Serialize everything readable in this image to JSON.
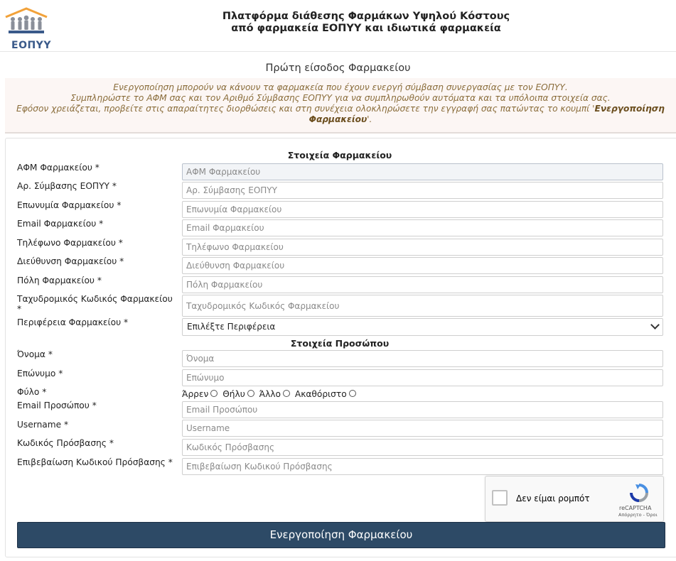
{
  "header": {
    "logo_text": "ΕΟΠΥΥ",
    "title_line1": "Πλατφόρμα διάθεσης Φαρμάκων Υψηλού Κόστους",
    "title_line2": "από φαρμακεία ΕΟΠΥΥ και ιδιωτικά φαρμακεία"
  },
  "page": {
    "subheading": "Πρώτη είσοδος Φαρμακείου"
  },
  "info": {
    "line1": "Ενεργοποίηση μπορούν να κάνουν τα φαρμακεία που έχουν ενεργή σύμβαση συνεργασίας με τον ΕΟΠΥΥ.",
    "line2": "Συμπληρώστε το ΑΦΜ σας και τον Αριθμό Σύμβασης ΕΟΠΥΥ για να συμπληρωθούν αυτόματα και τα υπόλοιπα στοιχεία σας.",
    "line3_prefix": "Εφόσον χρειάζεται, προβείτε στις απαραίτητες διορθώσεις και στη συνέχεια ολοκληρώσετε την εγγραφή σας πατώντας το κουμπί '",
    "line3_bold": "Ενεργοποίηση",
    "line4_bold": "Φαρμακείου",
    "line4_suffix": "'."
  },
  "pharmacy_section": {
    "title": "Στοιχεία Φαρμακείου",
    "fields": [
      {
        "label": "ΑΦΜ Φαρμακείου *",
        "placeholder": "ΑΦΜ Φαρμακείου",
        "value": ""
      },
      {
        "label": "Αρ. Σύμβασης ΕΟΠΥΥ *",
        "placeholder": "Αρ. Σύμβασης ΕΟΠΥΥ",
        "value": ""
      },
      {
        "label": "Επωνυμία Φαρμακείου *",
        "placeholder": "Επωνυμία Φαρμακείου",
        "value": ""
      },
      {
        "label": "Email Φαρμακείου *",
        "placeholder": "Email Φαρμακείου",
        "value": ""
      },
      {
        "label": "Τηλέφωνο Φαρμακείου *",
        "placeholder": "Τηλέφωνο Φαρμακείου",
        "value": ""
      },
      {
        "label": "Διεύθυνση Φαρμακείου *",
        "placeholder": "Διεύθυνση Φαρμακείου",
        "value": ""
      },
      {
        "label": "Πόλη Φαρμακείου *",
        "placeholder": "Πόλη Φαρμακείου",
        "value": ""
      },
      {
        "label": "Ταχυδρομικός Κωδικός Φαρμακείου *",
        "placeholder": "Ταχυδρομικός Κωδικός Φαρμακείου",
        "value": ""
      }
    ],
    "region": {
      "label": "Περιφέρεια Φαρμακείου *",
      "selected": "Επιλέξτε Περιφέρεια"
    }
  },
  "person_section": {
    "title": "Στοιχεία Προσώπου",
    "first_name": {
      "label": "Όνομα *",
      "placeholder": "Όνομα"
    },
    "last_name": {
      "label": "Επώνυμο *",
      "placeholder": "Επώνυμο"
    },
    "gender": {
      "label": "Φύλο *",
      "options": [
        "Άρρεν",
        "Θήλυ",
        "Άλλο",
        "Ακαθόριστο"
      ]
    },
    "email": {
      "label": "Email Προσώπου *",
      "placeholder": "Email Προσώπου"
    },
    "username": {
      "label": "Username *",
      "placeholder": "Username"
    },
    "password": {
      "label": "Κωδικός Πρόσβασης *",
      "placeholder": "Κωδικός Πρόσβασης"
    },
    "password_confirm": {
      "label": "Επιβεβαίωση Κωδικού Πρόσβασης *",
      "placeholder": "Επιβεβαίωση Κωδικού Πρόσβασης"
    }
  },
  "captcha": {
    "text": "Δεν είμαι ρομπότ",
    "brand": "reCAPTCHA",
    "links": "Απόρρητο - Όροι"
  },
  "submit_label": "Ενεργοποίηση Φαρμακείου",
  "colors": {
    "button_bg": "#2d4a66",
    "info_bg": "#fcf6f4",
    "info_text": "#8a6d3b",
    "logo_orange": "#f2a23a",
    "logo_blue": "#3a5a8a"
  }
}
